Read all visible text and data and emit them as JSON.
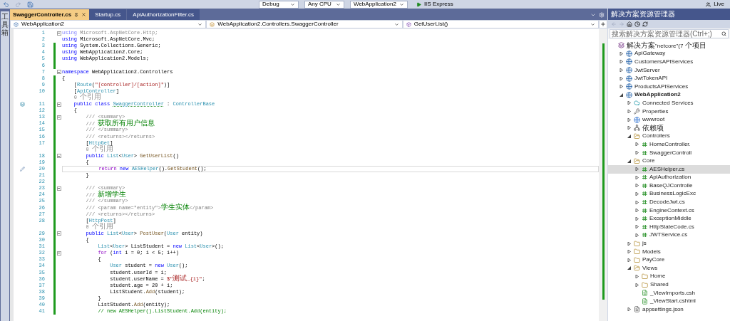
{
  "toolbar": {
    "items": [
      {
        "kind": "dropdown",
        "text": "Debug"
      },
      {
        "kind": "dropdown",
        "text": "Any CPU"
      },
      {
        "kind": "dropdown",
        "text": "WebApplication2"
      },
      {
        "kind": "run",
        "text": "IIS Express"
      },
      {
        "kind": "share",
        "text": "Live"
      }
    ]
  },
  "tabs": [
    {
      "label": "SwaggerController.cs",
      "selected": true
    },
    {
      "label": "Startup.cs",
      "selected": false
    },
    {
      "label": "ApiAuthorizationFilter.cs",
      "selected": false
    }
  ],
  "navigation_bar": {
    "project": "WebApplication2",
    "class": "WebApplication2.Controllers.SwaggerController",
    "member": "GetUserList()"
  },
  "editor": {
    "lines": [
      {
        "kind": "code",
        "number": "1",
        "changed": false,
        "fold": true,
        "current": false,
        "tokens": [
          {
            "text": "using",
            "kind": "faded-keyword"
          },
          {
            "text": " Microsoft.AspNetCore.Http;",
            "kind": "faded"
          }
        ]
      },
      {
        "kind": "code",
        "number": "2",
        "changed": false,
        "fold": false,
        "current": false,
        "tokens": [
          {
            "text": "using",
            "kind": "keyword"
          },
          {
            "text": " Microsoft.AspNetCore.Mvc;",
            "kind": "plain"
          }
        ]
      },
      {
        "kind": "code",
        "number": "3",
        "changed": true,
        "fold": false,
        "current": false,
        "tokens": [
          {
            "text": "using",
            "kind": "keyword"
          },
          {
            "text": " System.Collections.Generic;",
            "kind": "plain"
          }
        ]
      },
      {
        "kind": "code",
        "number": "4",
        "changed": true,
        "fold": false,
        "current": false,
        "tokens": [
          {
            "text": "using",
            "kind": "keyword"
          },
          {
            "text": " WebApplication2.Core;",
            "kind": "plain"
          }
        ]
      },
      {
        "kind": "code",
        "number": "5",
        "changed": true,
        "fold": false,
        "current": false,
        "tokens": [
          {
            "text": "using",
            "kind": "keyword"
          },
          {
            "text": " WebApplication2.Models;",
            "kind": "plain"
          }
        ]
      },
      {
        "kind": "code",
        "number": "6",
        "changed": true,
        "fold": false,
        "current": false
      },
      {
        "kind": "code",
        "number": "7",
        "changed": false,
        "fold": true,
        "current": false,
        "tokens": [
          {
            "text": "namespace",
            "kind": "keyword"
          },
          {
            "text": " WebApplication2.Controllers",
            "kind": "plain"
          }
        ]
      },
      {
        "kind": "code",
        "number": "8",
        "changed": true,
        "fold": false,
        "current": false,
        "tokens": [
          {
            "text": "{",
            "kind": "plain"
          }
        ]
      },
      {
        "kind": "code",
        "number": "9",
        "changed": true,
        "fold": false,
        "current": false,
        "tokens": [
          {
            "text": "    [",
            "kind": "plain"
          },
          {
            "text": "Route",
            "kind": "type"
          },
          {
            "text": "(",
            "kind": "plain"
          },
          {
            "text": "\"[controller]/[action]\"",
            "kind": "string"
          },
          {
            "text": ")]",
            "kind": "plain"
          }
        ]
      },
      {
        "kind": "code",
        "number": "10",
        "changed": true,
        "fold": false,
        "current": false,
        "tokens": [
          {
            "text": "    [",
            "kind": "plain"
          },
          {
            "text": "ApiController",
            "kind": "type"
          },
          {
            "text": "]",
            "kind": "plain"
          }
        ]
      },
      {
        "kind": "codelens",
        "changed": true,
        "fold": false,
        "current": false,
        "text": "    0 个引用"
      },
      {
        "kind": "code",
        "number": "11",
        "changed": true,
        "fold": true,
        "current": false,
        "gutter_icon": {
          "kind": "override"
        },
        "tokens": [
          {
            "text": "    public class ",
            "kind": "keyword"
          },
          {
            "text": "SwaggerController",
            "kind": "squiggle"
          },
          {
            "text": " : ",
            "kind": "plain"
          },
          {
            "text": "ControllerBase",
            "kind": "type"
          }
        ]
      },
      {
        "kind": "code",
        "number": "12",
        "changed": true,
        "fold": false,
        "current": false,
        "tokens": [
          {
            "text": "    {",
            "kind": "plain"
          }
        ]
      },
      {
        "kind": "code",
        "number": "13",
        "changed": true,
        "fold": true,
        "current": false,
        "tokens": [
          {
            "text": "        /// <summary>",
            "kind": "doc"
          }
        ]
      },
      {
        "kind": "code",
        "number": "14",
        "changed": true,
        "fold": false,
        "current": false,
        "tokens": [
          {
            "text": "        /// ",
            "kind": "doc"
          },
          {
            "text": "获取所有用户信息",
            "kind": "comment"
          }
        ]
      },
      {
        "kind": "code",
        "number": "15",
        "changed": true,
        "fold": false,
        "current": false,
        "tokens": [
          {
            "text": "        /// </summary>",
            "kind": "doc"
          }
        ]
      },
      {
        "kind": "code",
        "number": "16",
        "changed": true,
        "fold": false,
        "current": false,
        "tokens": [
          {
            "text": "        /// <returns></returns>",
            "kind": "doc"
          }
        ]
      },
      {
        "kind": "code",
        "number": "17",
        "changed": true,
        "fold": false,
        "current": false,
        "tokens": [
          {
            "text": "        [",
            "kind": "plain"
          },
          {
            "text": "HttpGet",
            "kind": "type"
          },
          {
            "text": "]",
            "kind": "plain"
          }
        ]
      },
      {
        "kind": "codelens",
        "changed": true,
        "fold": false,
        "current": false,
        "text": "        0 个引用"
      },
      {
        "kind": "code",
        "number": "18",
        "changed": true,
        "fold": true,
        "current": false,
        "tokens": [
          {
            "text": "        public ",
            "kind": "keyword"
          },
          {
            "text": "List",
            "kind": "type"
          },
          {
            "text": "<",
            "kind": "plain"
          },
          {
            "text": "User",
            "kind": "type"
          },
          {
            "text": "> ",
            "kind": "plain"
          },
          {
            "text": "GetUserList",
            "kind": "method"
          },
          {
            "text": "()",
            "kind": "plain"
          }
        ]
      },
      {
        "kind": "code",
        "number": "19",
        "changed": true,
        "fold": false,
        "current": false,
        "tokens": [
          {
            "text": "        {",
            "kind": "plain"
          }
        ]
      },
      {
        "kind": "code",
        "number": "20",
        "changed": true,
        "fold": false,
        "current": true,
        "gutter_icon": {
          "kind": "edit"
        },
        "tokens": [
          {
            "text": "            return ",
            "kind": "control"
          },
          {
            "text": "new ",
            "kind": "keyword"
          },
          {
            "text": "AESHelper",
            "kind": "type"
          },
          {
            "text": "().",
            "kind": "plain"
          },
          {
            "text": "GetStudent",
            "kind": "method"
          },
          {
            "text": "();",
            "kind": "plain"
          }
        ]
      },
      {
        "kind": "code",
        "number": "21",
        "changed": true,
        "fold": false,
        "current": false,
        "tokens": [
          {
            "text": "        }",
            "kind": "plain"
          }
        ]
      },
      {
        "kind": "code",
        "number": "22",
        "changed": true,
        "fold": false,
        "current": false
      },
      {
        "kind": "code",
        "number": "23",
        "changed": true,
        "fold": true,
        "current": false,
        "tokens": [
          {
            "text": "        /// <summary>",
            "kind": "doc"
          }
        ]
      },
      {
        "kind": "code",
        "number": "24",
        "changed": true,
        "fold": false,
        "current": false,
        "tokens": [
          {
            "text": "        /// ",
            "kind": "doc"
          },
          {
            "text": "新增学生",
            "kind": "comment"
          }
        ]
      },
      {
        "kind": "code",
        "number": "25",
        "changed": true,
        "fold": false,
        "current": false,
        "tokens": [
          {
            "text": "        /// </summary>",
            "kind": "doc"
          }
        ]
      },
      {
        "kind": "code",
        "number": "26",
        "changed": true,
        "fold": false,
        "current": false,
        "tokens": [
          {
            "text": "        /// <param name=\"entity\">",
            "kind": "doc"
          },
          {
            "text": "学生实体",
            "kind": "comment"
          },
          {
            "text": "</param>",
            "kind": "doc"
          }
        ]
      },
      {
        "kind": "code",
        "number": "27",
        "changed": true,
        "fold": false,
        "current": false,
        "tokens": [
          {
            "text": "        /// <returns></returns>",
            "kind": "doc"
          }
        ]
      },
      {
        "kind": "code",
        "number": "28",
        "changed": true,
        "fold": false,
        "current": false,
        "tokens": [
          {
            "text": "        [",
            "kind": "plain"
          },
          {
            "text": "HttpPost",
            "kind": "type"
          },
          {
            "text": "]",
            "kind": "plain"
          }
        ]
      },
      {
        "kind": "codelens",
        "changed": true,
        "fold": false,
        "current": false,
        "text": "        0 个引用"
      },
      {
        "kind": "code",
        "number": "29",
        "changed": true,
        "fold": true,
        "current": false,
        "tokens": [
          {
            "text": "        public ",
            "kind": "keyword"
          },
          {
            "text": "List",
            "kind": "type"
          },
          {
            "text": "<",
            "kind": "plain"
          },
          {
            "text": "User",
            "kind": "type"
          },
          {
            "text": "> ",
            "kind": "plain"
          },
          {
            "text": "PostUser",
            "kind": "method"
          },
          {
            "text": "(",
            "kind": "plain"
          },
          {
            "text": "User",
            "kind": "type"
          },
          {
            "text": " entity)",
            "kind": "plain"
          }
        ]
      },
      {
        "kind": "code",
        "number": "30",
        "changed": true,
        "fold": false,
        "current": false,
        "tokens": [
          {
            "text": "        {",
            "kind": "plain"
          }
        ]
      },
      {
        "kind": "code",
        "number": "31",
        "changed": true,
        "fold": false,
        "current": false,
        "tokens": [
          {
            "text": "            List",
            "kind": "type"
          },
          {
            "text": "<",
            "kind": "plain"
          },
          {
            "text": "User",
            "kind": "type"
          },
          {
            "text": "> ListStudent = ",
            "kind": "plain"
          },
          {
            "text": "new ",
            "kind": "keyword"
          },
          {
            "text": "List",
            "kind": "type"
          },
          {
            "text": "<",
            "kind": "plain"
          },
          {
            "text": "User",
            "kind": "type"
          },
          {
            "text": ">();",
            "kind": "plain"
          }
        ]
      },
      {
        "kind": "code",
        "number": "32",
        "changed": true,
        "fold": true,
        "current": false,
        "tokens": [
          {
            "text": "            for",
            "kind": "control"
          },
          {
            "text": " (",
            "kind": "plain"
          },
          {
            "text": "int",
            "kind": "keyword"
          },
          {
            "text": " i = 0; i < 5; i++)",
            "kind": "plain"
          }
        ]
      },
      {
        "kind": "code",
        "number": "33",
        "changed": true,
        "fold": false,
        "current": false,
        "tokens": [
          {
            "text": "            {",
            "kind": "plain"
          }
        ]
      },
      {
        "kind": "code",
        "number": "34",
        "changed": true,
        "fold": false,
        "current": false,
        "tokens": [
          {
            "text": "                User",
            "kind": "type"
          },
          {
            "text": " student = ",
            "kind": "plain"
          },
          {
            "text": "new ",
            "kind": "keyword"
          },
          {
            "text": "User",
            "kind": "type"
          },
          {
            "text": "();",
            "kind": "plain"
          }
        ]
      },
      {
        "kind": "code",
        "number": "35",
        "changed": true,
        "fold": false,
        "current": false,
        "tokens": [
          {
            "text": "                student.userId = i;",
            "kind": "plain"
          }
        ]
      },
      {
        "kind": "code",
        "number": "36",
        "changed": true,
        "fold": false,
        "current": false,
        "tokens": [
          {
            "text": "                student.userName = ",
            "kind": "plain"
          },
          {
            "text": "$\"测试_{i}\"",
            "kind": "string"
          },
          {
            "text": ";",
            "kind": "plain"
          }
        ]
      },
      {
        "kind": "code",
        "number": "37",
        "changed": true,
        "fold": false,
        "current": false,
        "tokens": [
          {
            "text": "                student.age = 20 + i;",
            "kind": "plain"
          }
        ]
      },
      {
        "kind": "code",
        "number": "38",
        "changed": true,
        "fold": false,
        "current": false,
        "tokens": [
          {
            "text": "                ListStudent.",
            "kind": "plain"
          },
          {
            "text": "Add",
            "kind": "method"
          },
          {
            "text": "(student);",
            "kind": "plain"
          }
        ]
      },
      {
        "kind": "code",
        "number": "39",
        "changed": true,
        "fold": false,
        "current": false,
        "tokens": [
          {
            "text": "            }",
            "kind": "plain"
          }
        ]
      },
      {
        "kind": "code",
        "number": "40",
        "changed": true,
        "fold": false,
        "current": false,
        "tokens": [
          {
            "text": "            ListStudent.",
            "kind": "plain"
          },
          {
            "text": "Add",
            "kind": "method"
          },
          {
            "text": "(entity);",
            "kind": "plain"
          }
        ]
      },
      {
        "kind": "code",
        "number": "41",
        "changed": true,
        "fold": false,
        "current": false,
        "tokens": [
          {
            "text": "            // new AESHelper().ListStudent.Add(entity);",
            "kind": "comment"
          }
        ]
      }
    ]
  },
  "solution_explorer": {
    "title": "解决方案资源管理器",
    "search": {
      "placeholder": "搜索解决方案资源管理器(Ctrl+;)"
    },
    "tree": [
      {
        "label": "解决方案\"netcore\"(7 个项目",
        "kind": "solution",
        "selected": false,
        "bold": false,
        "children": [
          {
            "label": "ApiGateway",
            "kind": "project",
            "expanded": false,
            "selected": false,
            "bold": false
          },
          {
            "label": "CustomersAPIServices",
            "kind": "project",
            "expanded": false,
            "selected": false,
            "bold": false
          },
          {
            "label": "JwtServer",
            "kind": "project",
            "expanded": false,
            "selected": false,
            "bold": false
          },
          {
            "label": "JwtTokenAPI",
            "kind": "project",
            "expanded": false,
            "selected": false,
            "bold": false
          },
          {
            "label": "ProductsAPIServices",
            "kind": "project",
            "expanded": false,
            "selected": false,
            "bold": false
          },
          {
            "label": "WebApplication2",
            "kind": "project",
            "expanded": true,
            "selected": false,
            "bold": true,
            "children": [
              {
                "label": "Connected Services",
                "kind": "connected",
                "expanded": false,
                "selected": false,
                "bold": false
              },
              {
                "label": "Properties",
                "kind": "properties",
                "expanded": false,
                "selected": false,
                "bold": false
              },
              {
                "label": "wwwroot",
                "kind": "web",
                "expanded": false,
                "selected": false,
                "bold": false
              },
              {
                "label": "依赖项",
                "kind": "dependencies",
                "expanded": false,
                "selected": false,
                "bold": false
              },
              {
                "label": "Controllers",
                "kind": "folder",
                "expanded": true,
                "selected": false,
                "bold": false,
                "children": [
                  {
                    "label": "HomeController.",
                    "kind": "csharp",
                    "expanded": false,
                    "selected": false,
                    "bold": false
                  },
                  {
                    "label": "SwaggerControll",
                    "kind": "csharp",
                    "expanded": false,
                    "selected": false,
                    "bold": false
                  }
                ]
              },
              {
                "label": "Core",
                "kind": "folder",
                "expanded": true,
                "selected": false,
                "bold": false,
                "children": [
                  {
                    "label": "AESHelper.cs",
                    "kind": "csharp",
                    "expanded": false,
                    "selected": true,
                    "bold": false
                  },
                  {
                    "label": "ApiAuthorization",
                    "kind": "csharp",
                    "expanded": false,
                    "selected": false,
                    "bold": false
                  },
                  {
                    "label": "BaseQJControlle",
                    "kind": "csharp",
                    "expanded": false,
                    "selected": false,
                    "bold": false
                  },
                  {
                    "label": "BusinessLogicExc",
                    "kind": "csharp",
                    "expanded": false,
                    "selected": false,
                    "bold": false
                  },
                  {
                    "label": "DecodeJwt.cs",
                    "kind": "csharp",
                    "expanded": false,
                    "selected": false,
                    "bold": false
                  },
                  {
                    "label": "EngineContext.cs",
                    "kind": "csharp",
                    "expanded": false,
                    "selected": false,
                    "bold": false
                  },
                  {
                    "label": "ExceptionMiddle",
                    "kind": "csharp",
                    "expanded": false,
                    "selected": false,
                    "bold": false
                  },
                  {
                    "label": "HttpStateCode.cs",
                    "kind": "csharp",
                    "expanded": false,
                    "selected": false,
                    "bold": false
                  },
                  {
                    "label": "JWTService.cs",
                    "kind": "csharp",
                    "expanded": false,
                    "selected": false,
                    "bold": false
                  }
                ]
              },
              {
                "label": "js",
                "kind": "folder",
                "expanded": false,
                "selected": false,
                "bold": false
              },
              {
                "label": "Models",
                "kind": "folder",
                "expanded": false,
                "selected": false,
                "bold": false
              },
              {
                "label": "PayCore",
                "kind": "folder",
                "expanded": false,
                "selected": false,
                "bold": false
              },
              {
                "label": "Views",
                "kind": "folder",
                "expanded": true,
                "selected": false,
                "bold": false,
                "children": [
                  {
                    "label": "Home",
                    "kind": "folder",
                    "expanded": false,
                    "selected": false,
                    "bold": false
                  },
                  {
                    "label": "Shared",
                    "kind": "folder",
                    "expanded": false,
                    "selected": false,
                    "bold": false
                  },
                  {
                    "label": "_ViewImports.csh",
                    "kind": "razor",
                    "selected": false,
                    "bold": false
                  },
                  {
                    "label": "_ViewStart.cshtml",
                    "kind": "razor",
                    "selected": false,
                    "bold": false
                  }
                ]
              },
              {
                "label": "appsettings.json",
                "kind": "json",
                "expanded": false,
                "selected": false,
                "bold": false
              }
            ]
          }
        ]
      }
    ]
  },
  "left_toolbox": {
    "label": "工具箱"
  }
}
